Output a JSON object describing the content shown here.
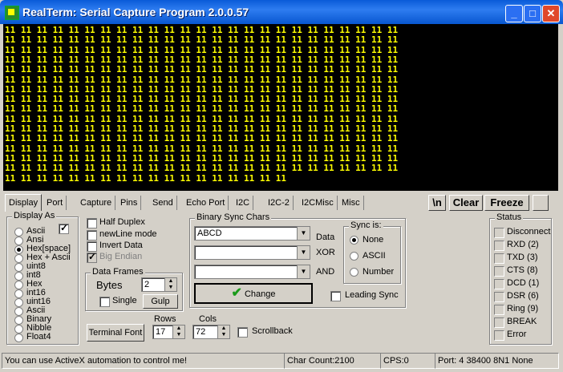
{
  "window": {
    "title": "RealTerm: Serial Capture Program 2.0.0.57",
    "min": "_",
    "max": "□",
    "close": "✕"
  },
  "terminal": {
    "lines": [
      "11 11 11 11 11 11 11 11 11 11 11 11 11 11 11 11 11 11 11 11 11 11 11 11 11",
      "11 11 11 11 11 11 11 11 11 11 11 11 11 11 11 11 11 11 11 11 11 11 11 11 11",
      "11 11 11 11 11 11 11 11 11 11 11 11 11 11 11 11 11 11 11 11 11 11 11 11 11",
      "11 11 11 11 11 11 11 11 11 11 11 11 11 11 11 11 11 11 11 11 11 11 11 11 11",
      "11 11 11 11 11 11 11 11 11 11 11 11 11 11 11 11 11 11 11 11 11 11 11 11 11",
      "11 11 11 11 11 11 11 11 11 11 11 11 11 11 11 11 11 11 11 11 11 11 11 11 11",
      "11 11 11 11 11 11 11 11 11 11 11 11 11 11 11 11 11 11 11 11 11 11 11 11 11",
      "11 11 11 11 11 11 11 11 11 11 11 11 11 11 11 11 11 11 11 11 11 11 11 11 11",
      "11 11 11 11 11 11 11 11 11 11 11 11 11 11 11 11 11 11 11 11 11 11 11 11 11",
      "11 11 11 11 11 11 11 11 11 11 11 11 11 11 11 11 11 11 11 11 11 11 11 11 11",
      "11 11 11 11 11 11 11 11 11 11 11 11 11 11 11 11 11 11 11 11 11 11 11 11 11",
      "11 11 11 11 11 11 11 11 11 11 11 11 11 11 11 11 11 11 11 11 11 11 11 11 11",
      "11 11 11 11 11 11 11 11 11 11 11 11 11 11 11 11 11 11 11 11 11 11 11 11 11",
      "11 11 11 11 11 11 11 11 11 11 11 11 11 11 11 11 11 11 11 11 11 11 11 11 11",
      "11 11 11 11 11 11 11 11 11 11 11 11 11 11 11 11 11 11 11 11 11 11 11 11 11",
      "11 11 11 11 11 11 11 11 11 11 11 11 11 11 11 11 11 11"
    ]
  },
  "tabs": [
    "Display",
    "Port",
    "Capture",
    "Pins",
    "Send",
    "Echo Port",
    "I2C",
    "I2C-2",
    "I2CMisc",
    "Misc"
  ],
  "toolbar": {
    "newline": "\\n",
    "clear": "Clear",
    "freeze": "Freeze"
  },
  "display_as": {
    "title": "Display As",
    "options": [
      "Ascii",
      "Ansi",
      "Hex[space]",
      "Hex + Ascii",
      "uint8",
      "int8",
      "Hex",
      "int16",
      "uint16",
      "Ascii",
      "Binary",
      "Nibble",
      "Float4"
    ],
    "selected": 2
  },
  "options": {
    "half_duplex": "Half Duplex",
    "newline_mode": "newLine mode",
    "invert_data": "Invert Data",
    "big_endian": "Big Endian"
  },
  "data_frames": {
    "title": "Data Frames",
    "bytes_label": "Bytes",
    "bytes_value": "2",
    "single": "Single",
    "gulp": "Gulp"
  },
  "binary_sync": {
    "title": "Binary Sync Chars",
    "field1": "ABCD",
    "field2": "",
    "field3": "",
    "data_label": "Data",
    "xor_label": "XOR",
    "and_label": "AND",
    "change": "Change",
    "sync_title": "Sync is:",
    "sync_none": "None",
    "sync_ascii": "ASCII",
    "sync_number": "Number",
    "leading_sync": "Leading Sync"
  },
  "terminal_font": "Terminal Font",
  "rows": {
    "label": "Rows",
    "value": "17"
  },
  "cols": {
    "label": "Cols",
    "value": "72"
  },
  "scrollback": "Scrollback",
  "status": {
    "title": "Status",
    "items": [
      "Disconnect",
      "RXD (2)",
      "TXD (3)",
      "CTS (8)",
      "DCD (1)",
      "DSR (6)",
      "Ring (9)",
      "BREAK",
      "Error"
    ]
  },
  "statusbar": {
    "message": "You can use ActiveX automation to control me!",
    "char_count": "Char Count:2100",
    "cps": "CPS:0",
    "port": "Port: 4 38400 8N1 None"
  }
}
